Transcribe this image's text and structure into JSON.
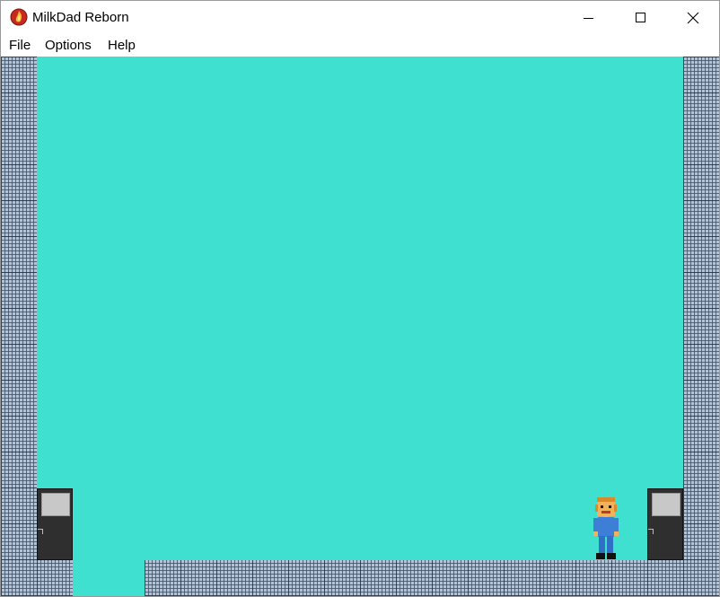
{
  "window": {
    "title": "MilkDad Reborn",
    "app_icon": "milkdad-flame-icon",
    "controls": [
      "minimize-icon",
      "maximize-icon",
      "close-icon"
    ]
  },
  "menu": {
    "items": [
      {
        "label": "File"
      },
      {
        "label": "Options"
      },
      {
        "label": "Help"
      }
    ]
  },
  "game": {
    "background_color": "#40e0d0",
    "tile_color": "#b4c4d8",
    "entities": [
      "left-door",
      "right-door",
      "player-character"
    ]
  }
}
